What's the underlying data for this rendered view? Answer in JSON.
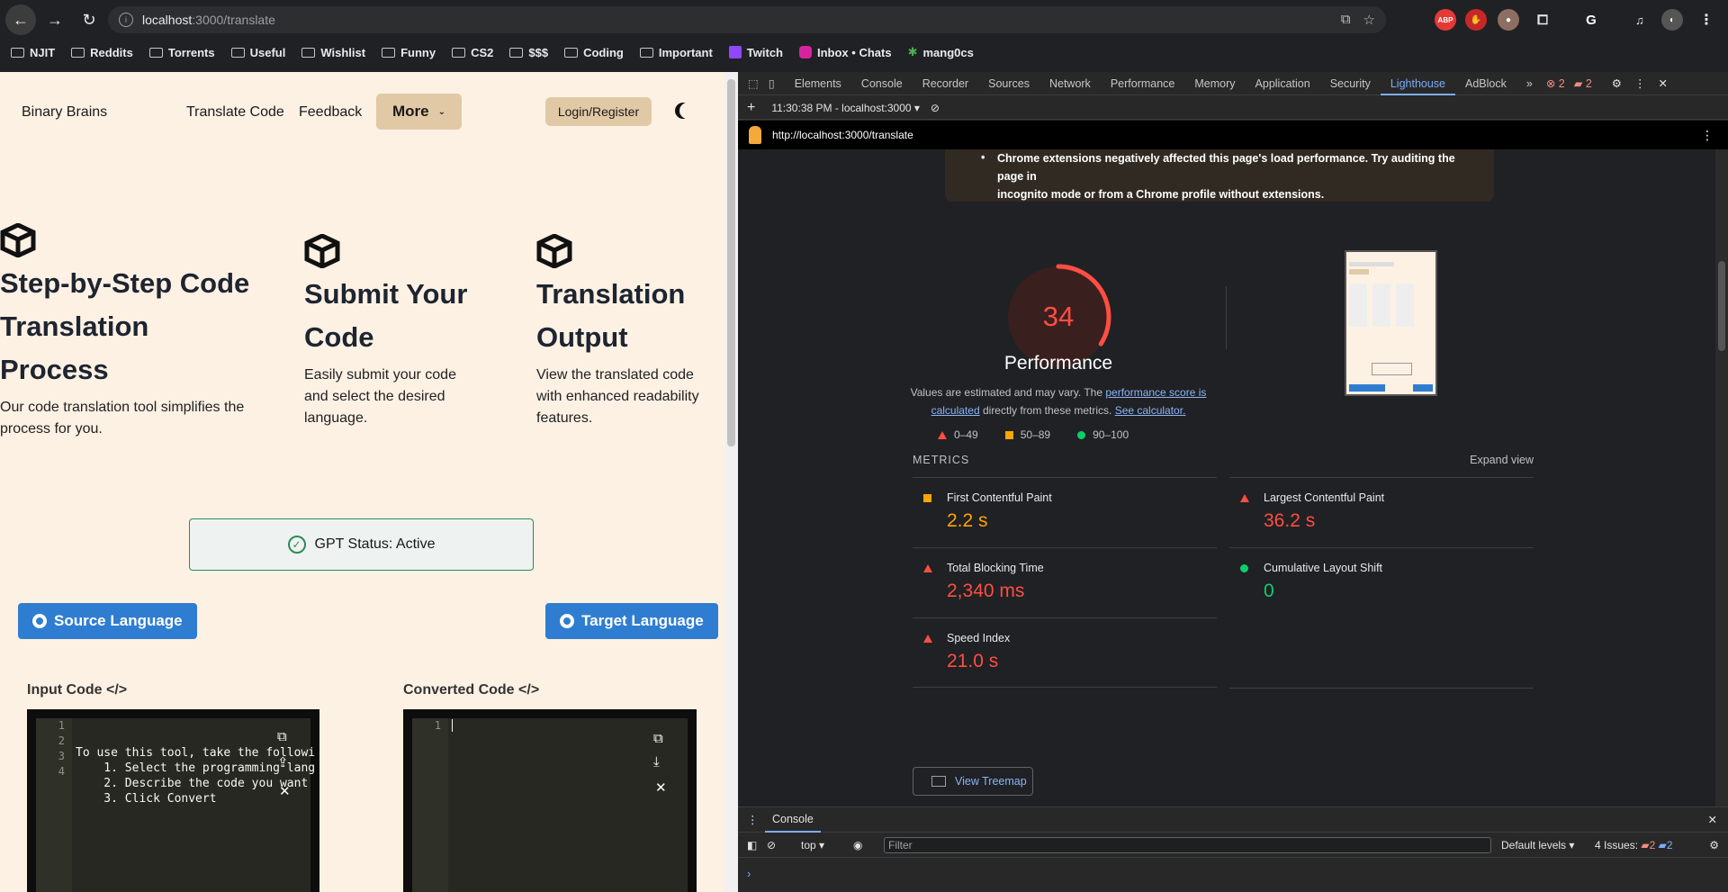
{
  "browser": {
    "url_host": "localhost",
    "url_rest": ":3000/translate",
    "bookmarks": [
      "NJIT",
      "Reddits",
      "Torrents",
      "Useful",
      "Wishlist",
      "Funny",
      "CS2",
      "$$$",
      "Coding",
      "Important",
      "Twitch",
      "Inbox • Chats",
      "mang0cs"
    ]
  },
  "app": {
    "brand": "Binary Brains",
    "nav": {
      "translate": "Translate Code",
      "feedback": "Feedback",
      "more": "More",
      "login": "Login/Register"
    },
    "features": [
      {
        "title_lines": [
          "Step-by-Step Code",
          "Translation",
          "Process"
        ],
        "desc_lines": [
          "Our code translation tool simplifies the",
          "process for you."
        ]
      },
      {
        "title_lines": [
          "Submit Your",
          "Code"
        ],
        "desc_lines": [
          "Easily submit your code",
          "and select the desired",
          "language."
        ]
      },
      {
        "title_lines": [
          "Translation",
          "Output"
        ],
        "desc_lines": [
          "View the translated code",
          "with enhanced readability",
          "features."
        ]
      }
    ],
    "gpt_status": "GPT Status: Active",
    "source_language": "Source Language",
    "target_language": "Target Language",
    "input_label": "Input Code",
    "converted_label": "Converted Code",
    "input_lines": [
      "To use this tool, take the followi",
      "    1. Select the programming lang",
      "    2. Describe the code you want",
      "    3. Click Convert"
    ],
    "input_line_numbers": [
      "1",
      "2",
      "3",
      "4"
    ],
    "output_line_numbers": [
      "1"
    ]
  },
  "devtools": {
    "tabs": [
      "Elements",
      "Console",
      "Recorder",
      "Sources",
      "Network",
      "Performance",
      "Memory",
      "Application",
      "Security",
      "Lighthouse",
      "AdBlock"
    ],
    "active_tab": "Lighthouse",
    "error_count": "2",
    "warning_count": "2",
    "report_time": "11:30:38 PM - localhost:3000",
    "report_url": "http://localhost:3000/translate",
    "warning_text_1": "Chrome extensions negatively affected this page's load performance. Try auditing the page in",
    "warning_text_2": "incognito mode or from a Chrome profile without extensions.",
    "score": 34,
    "score_title": "Performance",
    "note_pre": "Values are estimated and may vary. The ",
    "note_link": "performance score is calculated",
    "note_mid": " directly from these metrics. ",
    "note_link2": "See calculator.",
    "legend": {
      "poor": "0–49",
      "avg": "50–89",
      "good": "90–100"
    },
    "metrics_heading": "METRICS",
    "expand": "Expand view",
    "metrics": [
      {
        "label": "First Contentful Paint",
        "value": "2.2 s",
        "status": "average",
        "color": "#ffa400"
      },
      {
        "label": "Largest Contentful Paint",
        "value": "36.2 s",
        "status": "poor",
        "color": "#ff4e42"
      },
      {
        "label": "Total Blocking Time",
        "value": "2,340 ms",
        "status": "poor",
        "color": "#ff4e42"
      },
      {
        "label": "Cumulative Layout Shift",
        "value": "0",
        "status": "good",
        "color": "#0cce6b"
      },
      {
        "label": "Speed Index",
        "value": "21.0 s",
        "status": "poor",
        "color": "#ff4e42"
      }
    ],
    "treemap": "View Treemap",
    "console": {
      "tab": "Console",
      "context": "top",
      "filter_placeholder": "Filter",
      "levels": "Default levels",
      "issues_label": "4 Issues:",
      "issues_errors": "2",
      "issues_info": "2"
    }
  }
}
